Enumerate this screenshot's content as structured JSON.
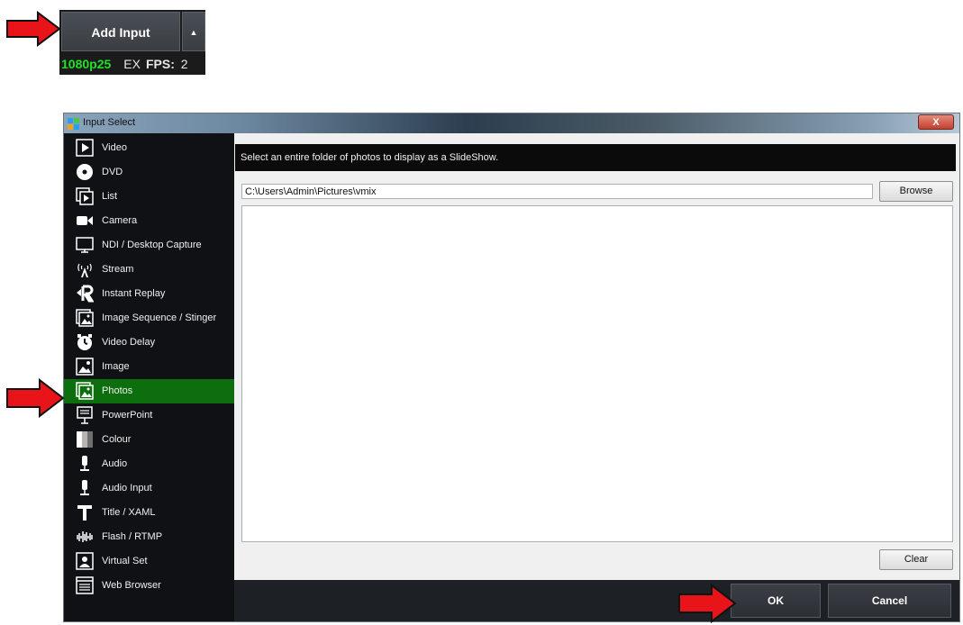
{
  "top_panel": {
    "add_input_label": "Add Input",
    "dropdown_glyph": "▲",
    "resolution": "1080p25",
    "ex_label": "EX",
    "fps_label": "FPS:",
    "fps_value": "2"
  },
  "dialog": {
    "title": "Input Select",
    "close_label": "X",
    "sidebar": {
      "items": [
        {
          "label": "Video",
          "icon": "video-icon"
        },
        {
          "label": "DVD",
          "icon": "dvd-icon"
        },
        {
          "label": "List",
          "icon": "list-icon"
        },
        {
          "label": "Camera",
          "icon": "camera-icon"
        },
        {
          "label": "NDI / Desktop Capture",
          "icon": "monitor-icon"
        },
        {
          "label": "Stream",
          "icon": "stream-icon"
        },
        {
          "label": "Instant Replay",
          "icon": "replay-icon"
        },
        {
          "label": "Image Sequence / Stinger",
          "icon": "image-sequence-icon"
        },
        {
          "label": "Video Delay",
          "icon": "timer-icon"
        },
        {
          "label": "Image",
          "icon": "image-icon"
        },
        {
          "label": "Photos",
          "icon": "photos-icon",
          "selected": true
        },
        {
          "label": "PowerPoint",
          "icon": "presentation-icon"
        },
        {
          "label": "Colour",
          "icon": "colour-icon"
        },
        {
          "label": "Audio",
          "icon": "microphone-icon"
        },
        {
          "label": "Audio Input",
          "icon": "microphone-icon"
        },
        {
          "label": "Title / XAML",
          "icon": "title-icon"
        },
        {
          "label": "Flash / RTMP",
          "icon": "waveform-icon"
        },
        {
          "label": "Virtual Set",
          "icon": "virtual-set-icon"
        },
        {
          "label": "Web Browser",
          "icon": "browser-icon"
        }
      ]
    },
    "main": {
      "description": "Select an entire folder of photos to display as a SlideShow.",
      "path_value": "C:\\Users\\Admin\\Pictures\\vmix",
      "browse_label": "Browse",
      "clear_label": "Clear",
      "ok_label": "OK",
      "cancel_label": "Cancel"
    }
  },
  "colors": {
    "selected_item": "#0d6e0d",
    "resolution_text": "#21e02a",
    "annotation_arrow": "#e8141a"
  }
}
